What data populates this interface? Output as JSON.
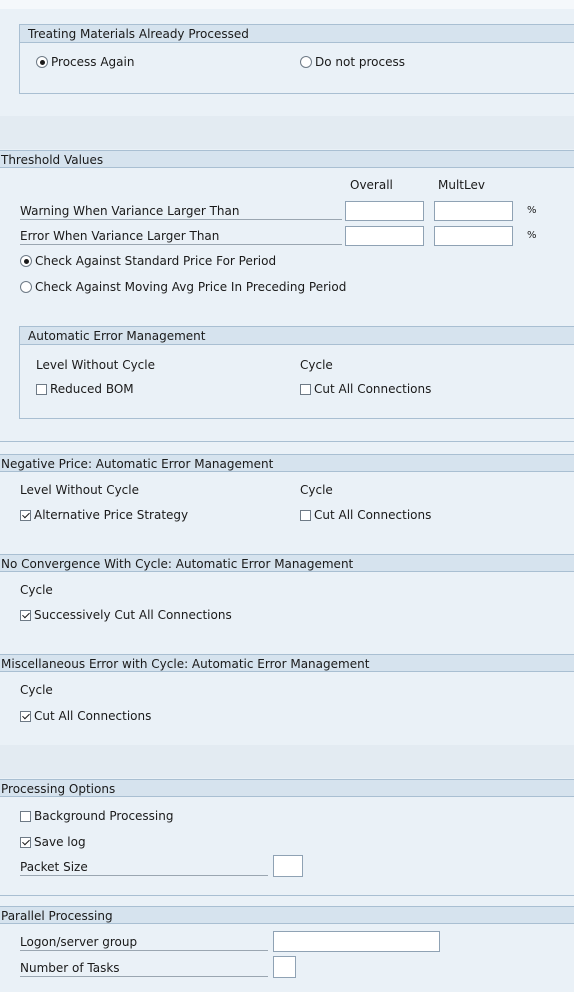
{
  "treating": {
    "title": "Treating Materials Already Processed",
    "options": [
      {
        "label": "Process Again",
        "selected": true
      },
      {
        "label": "Do not process",
        "selected": false
      }
    ]
  },
  "threshold": {
    "title": "Threshold Values",
    "col_overall": "Overall",
    "col_multlev": "MultLev",
    "warning_label": "Warning When Variance Larger Than",
    "error_label": "Error When Variance Larger Than",
    "unit": "%",
    "warning_overall": "",
    "warning_multlev": "",
    "error_overall": "",
    "error_multlev": "",
    "price_options": [
      {
        "label": "Check Against Standard Price For Period",
        "selected": true
      },
      {
        "label": "Check Against Moving Avg Price In Preceding Period",
        "selected": false
      }
    ]
  },
  "auto_error": {
    "title": "Automatic Error Management",
    "col_no_cycle": "Level Without Cycle",
    "col_cycle": "Cycle",
    "reduced_bom": {
      "label": "Reduced BOM",
      "checked": false
    },
    "cut_all": {
      "label": "Cut All Connections",
      "checked": false
    }
  },
  "negative_price": {
    "title": "Negative Price: Automatic Error Management",
    "col_no_cycle": "Level Without Cycle",
    "col_cycle": "Cycle",
    "alt_price": {
      "label": "Alternative Price Strategy",
      "checked": true
    },
    "cut_all": {
      "label": "Cut All Connections",
      "checked": false
    }
  },
  "no_convergence": {
    "title": "No Convergence With Cycle: Automatic Error Management",
    "col_cycle": "Cycle",
    "successively": {
      "label": "Successively Cut All Connections",
      "checked": true
    }
  },
  "misc_error": {
    "title": "Miscellaneous Error with Cycle: Automatic Error Management",
    "col_cycle": "Cycle",
    "cut_all": {
      "label": "Cut All Connections",
      "checked": true
    }
  },
  "processing": {
    "title": "Processing Options",
    "background": {
      "label": "Background Processing",
      "checked": false
    },
    "save_log": {
      "label": "Save log",
      "checked": true
    },
    "packet_size_label": "Packet Size",
    "packet_size": ""
  },
  "parallel": {
    "title": "Parallel Processing",
    "logon_label": "Logon/server group",
    "logon_value": "",
    "tasks_label": "Number of Tasks",
    "tasks_value": ""
  }
}
